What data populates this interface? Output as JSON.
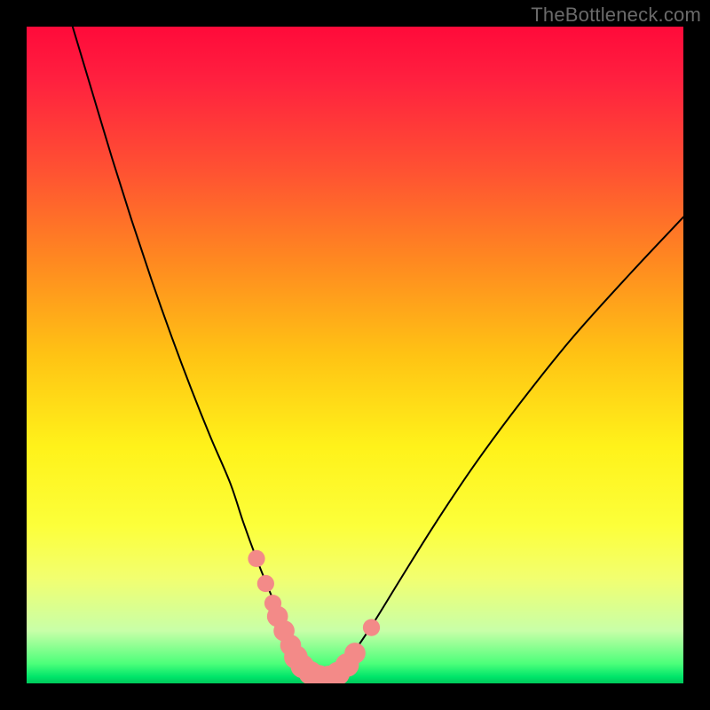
{
  "watermark": "TheBottleneck.com",
  "chart_data": {
    "type": "line",
    "title": "",
    "xlabel": "",
    "ylabel": "",
    "xlim": [
      0,
      100
    ],
    "ylim": [
      0,
      100
    ],
    "grid": false,
    "legend": false,
    "background_gradient": {
      "stops": [
        {
          "pct": 0,
          "color": "#ff0a3a"
        },
        {
          "pct": 50,
          "color": "#ffc314"
        },
        {
          "pct": 76,
          "color": "#fcff3a"
        },
        {
          "pct": 97,
          "color": "#4cff7a"
        },
        {
          "pct": 100,
          "color": "#00c85a"
        }
      ]
    },
    "series": [
      {
        "name": "bottleneck-curve",
        "color": "#000000",
        "x": [
          7,
          10,
          13,
          16,
          19,
          22,
          25,
          28,
          31,
          33,
          35,
          36.8,
          38.5,
          40,
          41,
          42,
          43,
          44,
          46,
          48,
          50,
          53,
          57,
          62,
          68,
          75,
          83,
          92,
          100
        ],
        "y": [
          100,
          90,
          80,
          70.5,
          61.5,
          53,
          45,
          37.5,
          30.5,
          24.5,
          19,
          14.5,
          10.5,
          7.2,
          5.0,
          3.2,
          1.8,
          1.0,
          0.7,
          2.2,
          5.0,
          9.5,
          16,
          24,
          33,
          42.5,
          52.5,
          62.5,
          71
        ]
      }
    ],
    "markers": {
      "name": "highlighted-points",
      "color": "#f38a88",
      "points": [
        {
          "x": 35.0,
          "y": 19.0,
          "r": 1.3
        },
        {
          "x": 36.4,
          "y": 15.2,
          "r": 1.3
        },
        {
          "x": 37.5,
          "y": 12.2,
          "r": 1.3
        },
        {
          "x": 38.2,
          "y": 10.2,
          "r": 1.6
        },
        {
          "x": 39.2,
          "y": 8.0,
          "r": 1.6
        },
        {
          "x": 40.2,
          "y": 5.8,
          "r": 1.6
        },
        {
          "x": 41.0,
          "y": 4.0,
          "r": 1.8
        },
        {
          "x": 42.0,
          "y": 2.6,
          "r": 1.8
        },
        {
          "x": 43.2,
          "y": 1.6,
          "r": 1.8
        },
        {
          "x": 44.5,
          "y": 1.0,
          "r": 1.8
        },
        {
          "x": 46.0,
          "y": 0.9,
          "r": 1.8
        },
        {
          "x": 47.4,
          "y": 1.5,
          "r": 1.8
        },
        {
          "x": 48.8,
          "y": 2.8,
          "r": 1.8
        },
        {
          "x": 50.0,
          "y": 4.6,
          "r": 1.6
        },
        {
          "x": 52.5,
          "y": 8.5,
          "r": 1.3
        }
      ]
    }
  }
}
